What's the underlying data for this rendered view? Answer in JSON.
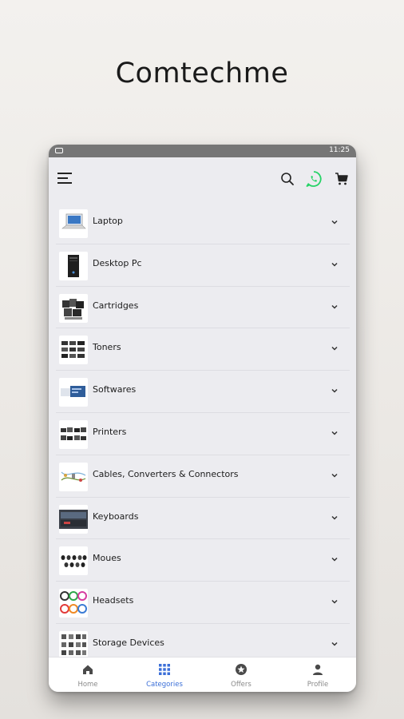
{
  "brand": {
    "title": "Comtechme"
  },
  "status_bar": {
    "time": "11:25"
  },
  "categories": [
    {
      "label": "Laptop",
      "icon": "laptop"
    },
    {
      "label": "Desktop Pc",
      "icon": "desktop"
    },
    {
      "label": "Cartridges",
      "icon": "cartridges"
    },
    {
      "label": "Toners",
      "icon": "toners"
    },
    {
      "label": "Softwares",
      "icon": "softwares"
    },
    {
      "label": "Printers",
      "icon": "printers"
    },
    {
      "label": "Cables, Converters & Connectors",
      "icon": "cables"
    },
    {
      "label": "Keyboards",
      "icon": "keyboards"
    },
    {
      "label": "Moues",
      "icon": "mouse"
    },
    {
      "label": "Headsets",
      "icon": "headsets"
    },
    {
      "label": "Storage Devices",
      "icon": "storage"
    }
  ],
  "bottom_nav": {
    "items": [
      {
        "label": "Home",
        "icon": "home-icon",
        "active": false
      },
      {
        "label": "Categories",
        "icon": "grid-icon",
        "active": true
      },
      {
        "label": "Offers",
        "icon": "star-icon",
        "active": false
      },
      {
        "label": "Profile",
        "icon": "person-icon",
        "active": false
      }
    ]
  },
  "colors": {
    "accent": "#3b6fd8",
    "whatsapp": "#25d366",
    "status_bar": "#767676",
    "background": "#ececf0"
  }
}
